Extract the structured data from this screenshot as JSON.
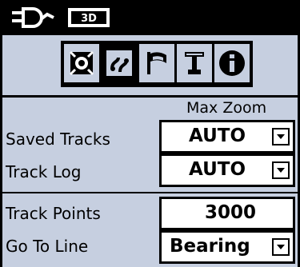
{
  "status": {
    "icons": [
      "device-icon",
      "3d-fix-icon"
    ],
    "fix_label": "3D"
  },
  "tabs": {
    "items": [
      {
        "name": "map-tab",
        "icon": "crosshair-target"
      },
      {
        "name": "tracks-tab",
        "icon": "tracks"
      },
      {
        "name": "routes-tab",
        "icon": "flag"
      },
      {
        "name": "text-tab",
        "icon": "text"
      },
      {
        "name": "info-tab",
        "icon": "info"
      }
    ],
    "selected_index": 1
  },
  "header": {
    "max_zoom_label": "Max Zoom"
  },
  "rows": {
    "saved_tracks": {
      "label": "Saved Tracks",
      "value": "AUTO"
    },
    "track_log": {
      "label": "Track Log",
      "value": "AUTO"
    },
    "track_points": {
      "label": "Track Points",
      "value": "3000"
    },
    "go_to_line": {
      "label": "Go To Line",
      "value": "Bearing"
    }
  }
}
